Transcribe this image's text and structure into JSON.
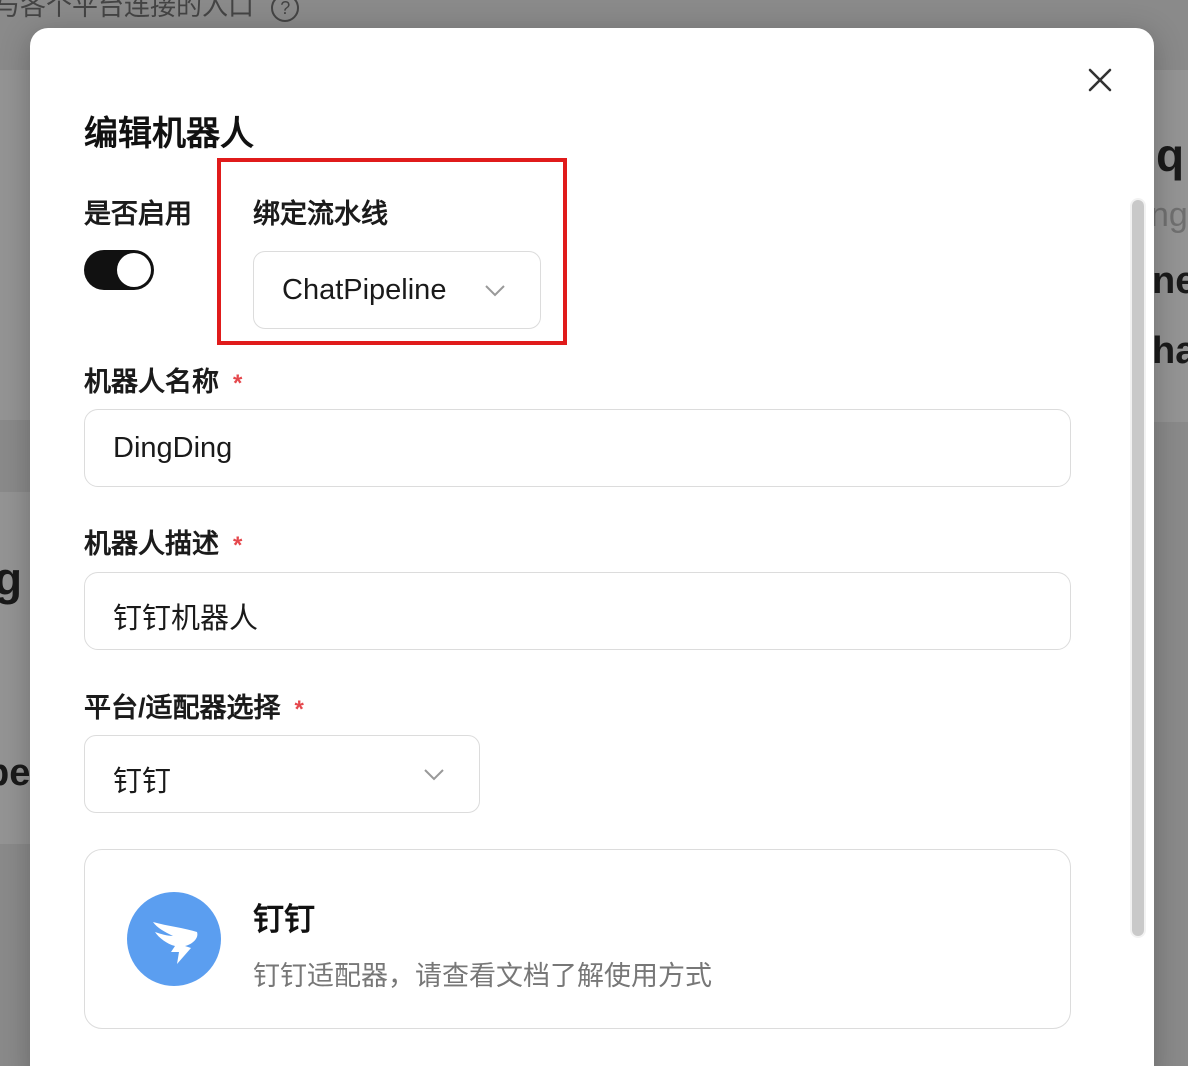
{
  "background": {
    "top_text": "与各个平台连接的入口",
    "help_icon": "?",
    "fragments_right": [
      "q",
      "ng",
      "ne",
      "ha"
    ],
    "fragments_left": [
      "g",
      "pe"
    ]
  },
  "modal": {
    "title": "编辑机器人",
    "close_icon": "close-icon"
  },
  "form": {
    "enabled": {
      "label": "是否启用",
      "value": true
    },
    "pipeline": {
      "label": "绑定流水线",
      "value": "ChatPipeline"
    },
    "name": {
      "label": "机器人名称",
      "required_mark": "*",
      "value": "DingDing"
    },
    "description": {
      "label": "机器人描述",
      "required_mark": "*",
      "value": "钉钉机器人"
    },
    "adapter": {
      "label": "平台/适配器选择",
      "required_mark": "*",
      "value": "钉钉"
    }
  },
  "adapter_card": {
    "name": "钉钉",
    "description": "钉钉适配器，请查看文档了解使用方式",
    "logo_icon": "dingtalk-logo-icon"
  },
  "colors": {
    "highlight": "#e01b1b",
    "required": "#e5484d",
    "toggle_on": "#111111",
    "dingtalk_blue": "#5b9ef0"
  }
}
